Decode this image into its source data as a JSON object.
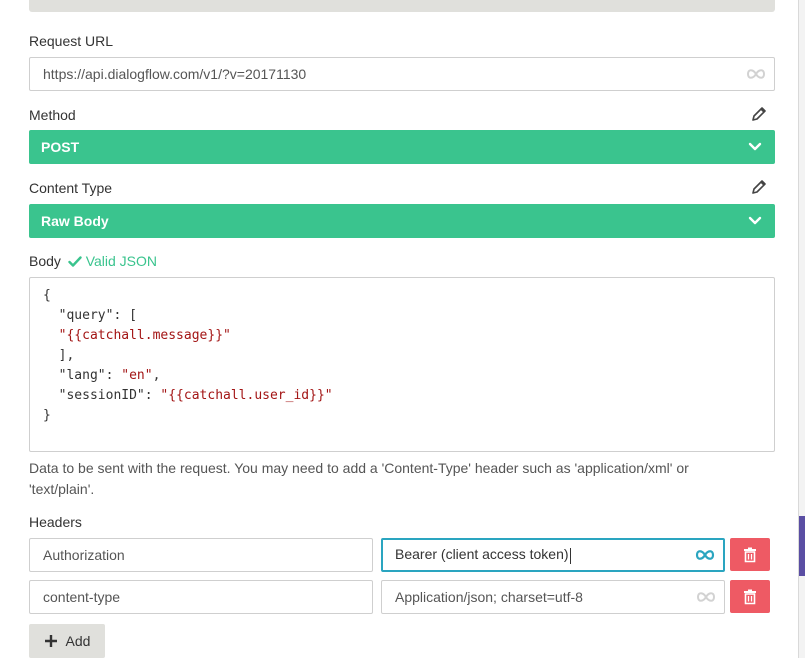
{
  "request_url": {
    "label": "Request URL",
    "value": "https://api.dialogflow.com/v1/?v=20171130"
  },
  "method": {
    "label": "Method",
    "value": "POST"
  },
  "content_type": {
    "label": "Content Type",
    "value": "Raw Body"
  },
  "body": {
    "label": "Body",
    "valid_text": "Valid JSON",
    "lines": [
      {
        "plain": "{",
        "str": "",
        "tail": ""
      },
      {
        "plain": "  \"query\": [",
        "str": "",
        "tail": ""
      },
      {
        "plain": "  ",
        "str": "\"{{catchall.message}}\"",
        "tail": ""
      },
      {
        "plain": "  ],",
        "str": "",
        "tail": ""
      },
      {
        "plain": "  \"lang\": ",
        "str": "\"en\"",
        "tail": ","
      },
      {
        "plain": "  \"sessionID\": ",
        "str": "\"{{catchall.user_id}}\"",
        "tail": ""
      },
      {
        "plain": "}",
        "str": "",
        "tail": ""
      }
    ],
    "help_text": "Data to be sent with the request. You may need to add a 'Content-Type' header such as 'application/xml' or 'text/plain'."
  },
  "headers": {
    "label": "Headers",
    "rows": [
      {
        "key": "Authorization",
        "value": "Bearer (client access token)"
      },
      {
        "key": "content-type",
        "value": "Application/json; charset=utf-8"
      }
    ]
  },
  "add_label": "Add",
  "colors": {
    "accent_green": "#3ac48e",
    "danger_red": "#ee5a64",
    "focus_teal": "#2aa5c0"
  },
  "icons": [
    "pencil-icon",
    "chevron-down-icon",
    "check-icon",
    "loop-icon",
    "trash-icon",
    "plus-icon"
  ]
}
